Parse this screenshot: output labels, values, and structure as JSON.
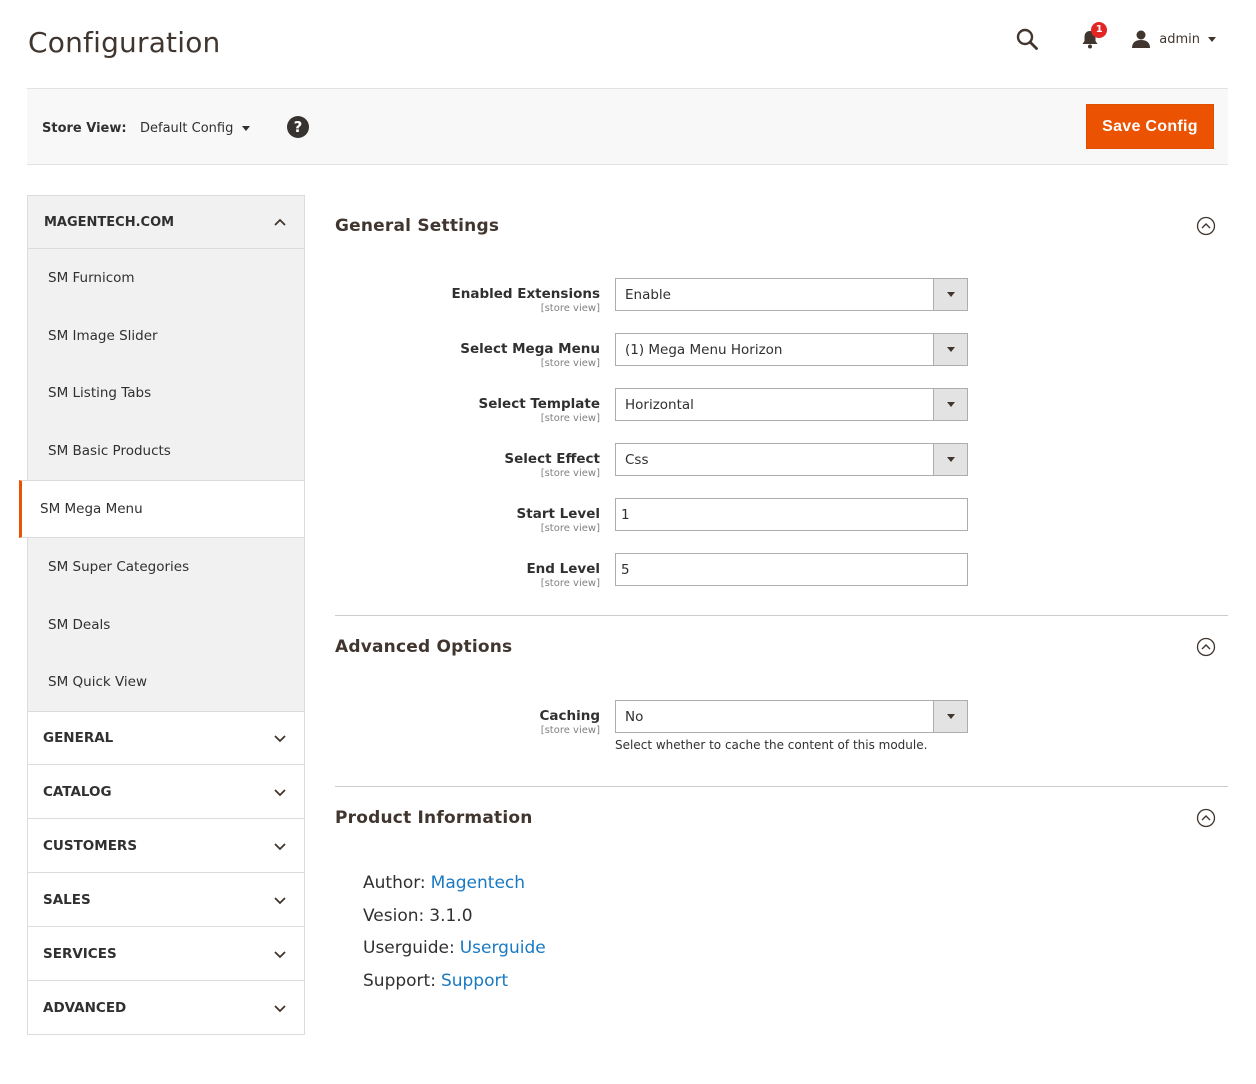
{
  "page": {
    "title": "Configuration"
  },
  "header": {
    "notification_count": "1",
    "user_name": "admin"
  },
  "store_bar": {
    "label": "Store View:",
    "selected": "Default Config",
    "help": "?",
    "save_label": "Save Config"
  },
  "sidebar": {
    "group_title": "MAGENTECH.COM",
    "items": [
      {
        "label": "SM Furnicom"
      },
      {
        "label": "SM Image Slider"
      },
      {
        "label": "SM Listing Tabs"
      },
      {
        "label": "SM Basic Products"
      },
      {
        "label": "SM Mega Menu",
        "active": true
      },
      {
        "label": "SM Super Categories"
      },
      {
        "label": "SM Deals"
      },
      {
        "label": "SM Quick View"
      }
    ],
    "categories": [
      {
        "label": "GENERAL"
      },
      {
        "label": "CATALOG"
      },
      {
        "label": "CUSTOMERS"
      },
      {
        "label": "SALES"
      },
      {
        "label": "SERVICES"
      },
      {
        "label": "ADVANCED"
      }
    ]
  },
  "general_settings": {
    "title": "General Settings",
    "fields": {
      "enabled_extensions": {
        "label": "Enabled Extensions",
        "scope": "[store view]",
        "value": "Enable"
      },
      "select_mega_menu": {
        "label": "Select Mega Menu",
        "scope": "[store view]",
        "value": "(1) Mega Menu Horizon"
      },
      "select_template": {
        "label": "Select Template",
        "scope": "[store view]",
        "value": "Horizontal"
      },
      "select_effect": {
        "label": "Select Effect",
        "scope": "[store view]",
        "value": "Css"
      },
      "start_level": {
        "label": "Start Level",
        "scope": "[store view]",
        "value": "1"
      },
      "end_level": {
        "label": "End Level",
        "scope": "[store view]",
        "value": "5"
      }
    }
  },
  "advanced_options": {
    "title": "Advanced Options",
    "caching": {
      "label": "Caching",
      "scope": "[store view]",
      "value": "No",
      "note": "Select whether to cache the content of this module."
    }
  },
  "product_information": {
    "title": "Product Information",
    "author_label": "Author:",
    "author_link": "Magentech",
    "version_label": "Vesion:",
    "version_value": "3.1.0",
    "userguide_label": "Userguide:",
    "userguide_link": "Userguide",
    "support_label": "Support:",
    "support_link": "Support"
  },
  "colors": {
    "accent": "#eb5202",
    "link": "#1979c3",
    "badge": "#e22626"
  }
}
